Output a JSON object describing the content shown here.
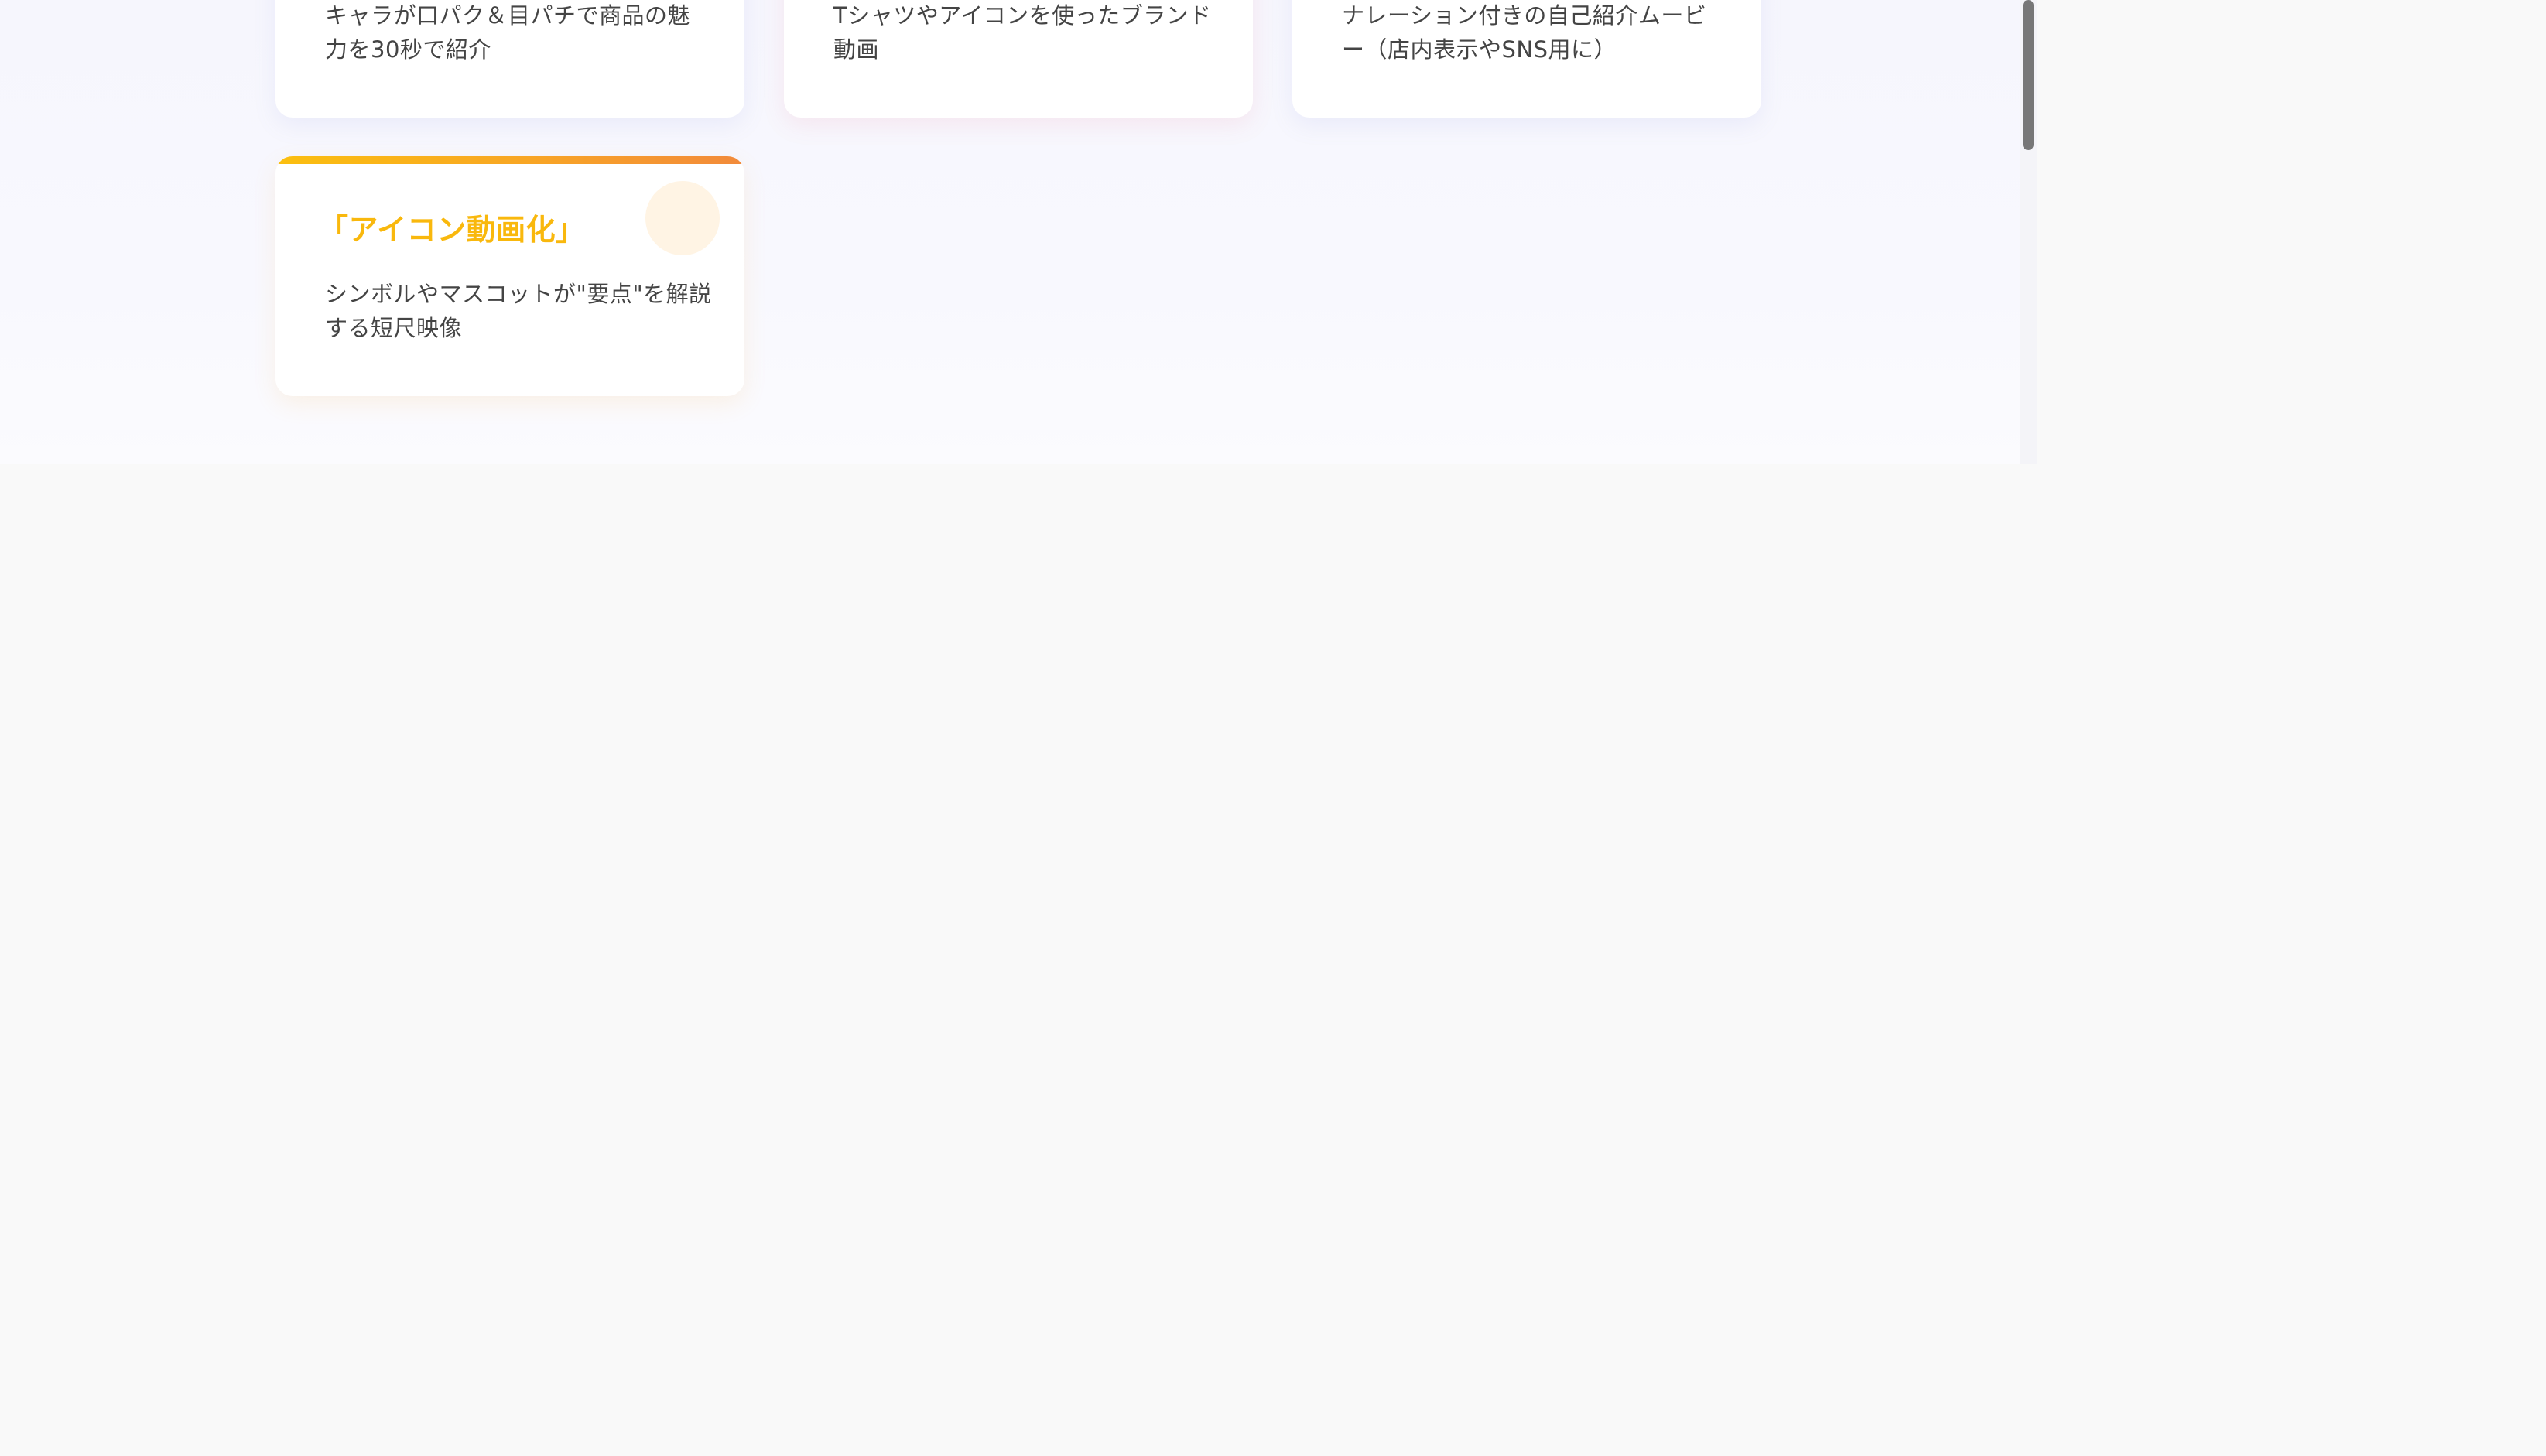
{
  "cards": [
    {
      "description": "キャラが口パク＆目パチで商品の魅力を30秒で紹介"
    },
    {
      "description": "Tシャツやアイコンを使ったブランド動画"
    },
    {
      "description": "ナレーション付きの自己紹介ムービー（店内表示やSNS用に）"
    },
    {
      "title": "「アイコン動画化」",
      "description": "シンボルやマスコットが\"要点\"を解説する短尺映像"
    }
  ],
  "colors": {
    "page_background": "#f9f9f9",
    "frame_background": "#f7f7fd",
    "card_background": "#ffffff",
    "title_accent": "#f9b80d",
    "accent_gradient_start": "#fbbf0f",
    "accent_gradient_end": "#f28a3b",
    "body_text": "#444444",
    "scrollbar_thumb": "#777777"
  },
  "icons": {
    "card_decoration": "circle-decoration-icon"
  }
}
